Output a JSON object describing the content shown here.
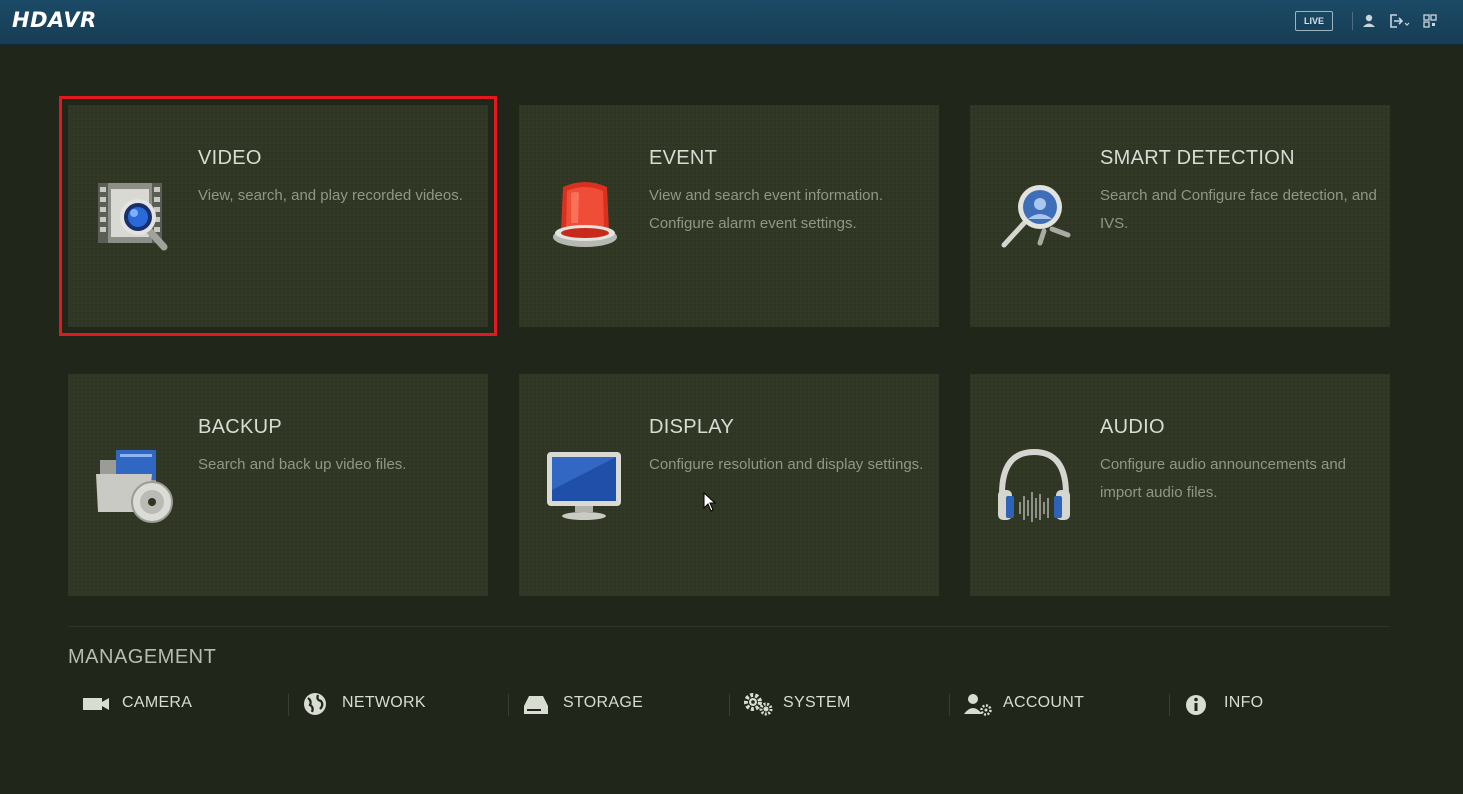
{
  "header": {
    "brand": "HDAVR",
    "live_label": "LIVE",
    "icons": [
      "user-icon",
      "logout-icon",
      "qr-icon"
    ]
  },
  "tiles": [
    {
      "title": "VIDEO",
      "desc": "View, search, and play recorded videos.",
      "icon": "video-search-icon",
      "selected": true
    },
    {
      "title": "EVENT",
      "desc": "View and search event information. Configure alarm event settings.",
      "icon": "alarm-light-icon",
      "selected": false
    },
    {
      "title": "SMART DETECTION",
      "desc": "Search and Configure face detection, and IVS.",
      "icon": "magnifier-face-icon",
      "selected": false
    },
    {
      "title": "BACKUP",
      "desc": "Search and back up video files.",
      "icon": "folder-disc-icon",
      "selected": false
    },
    {
      "title": "DISPLAY",
      "desc": "Configure resolution and display settings.",
      "icon": "monitor-icon",
      "selected": false
    },
    {
      "title": "AUDIO",
      "desc": "Configure audio announcements and import audio files.",
      "icon": "headphones-icon",
      "selected": false
    }
  ],
  "management": {
    "title": "MANAGEMENT",
    "items": [
      {
        "label": "CAMERA",
        "icon": "camera-icon"
      },
      {
        "label": "NETWORK",
        "icon": "network-globe-icon"
      },
      {
        "label": "STORAGE",
        "icon": "storage-drive-icon"
      },
      {
        "label": "SYSTEM",
        "icon": "gears-icon"
      },
      {
        "label": "ACCOUNT",
        "icon": "user-settings-icon"
      },
      {
        "label": "INFO",
        "icon": "info-icon"
      }
    ]
  },
  "colors": {
    "background": "#202619",
    "tile": "#2f3624",
    "header": "#1b4a66",
    "selection": "#e3191f"
  }
}
